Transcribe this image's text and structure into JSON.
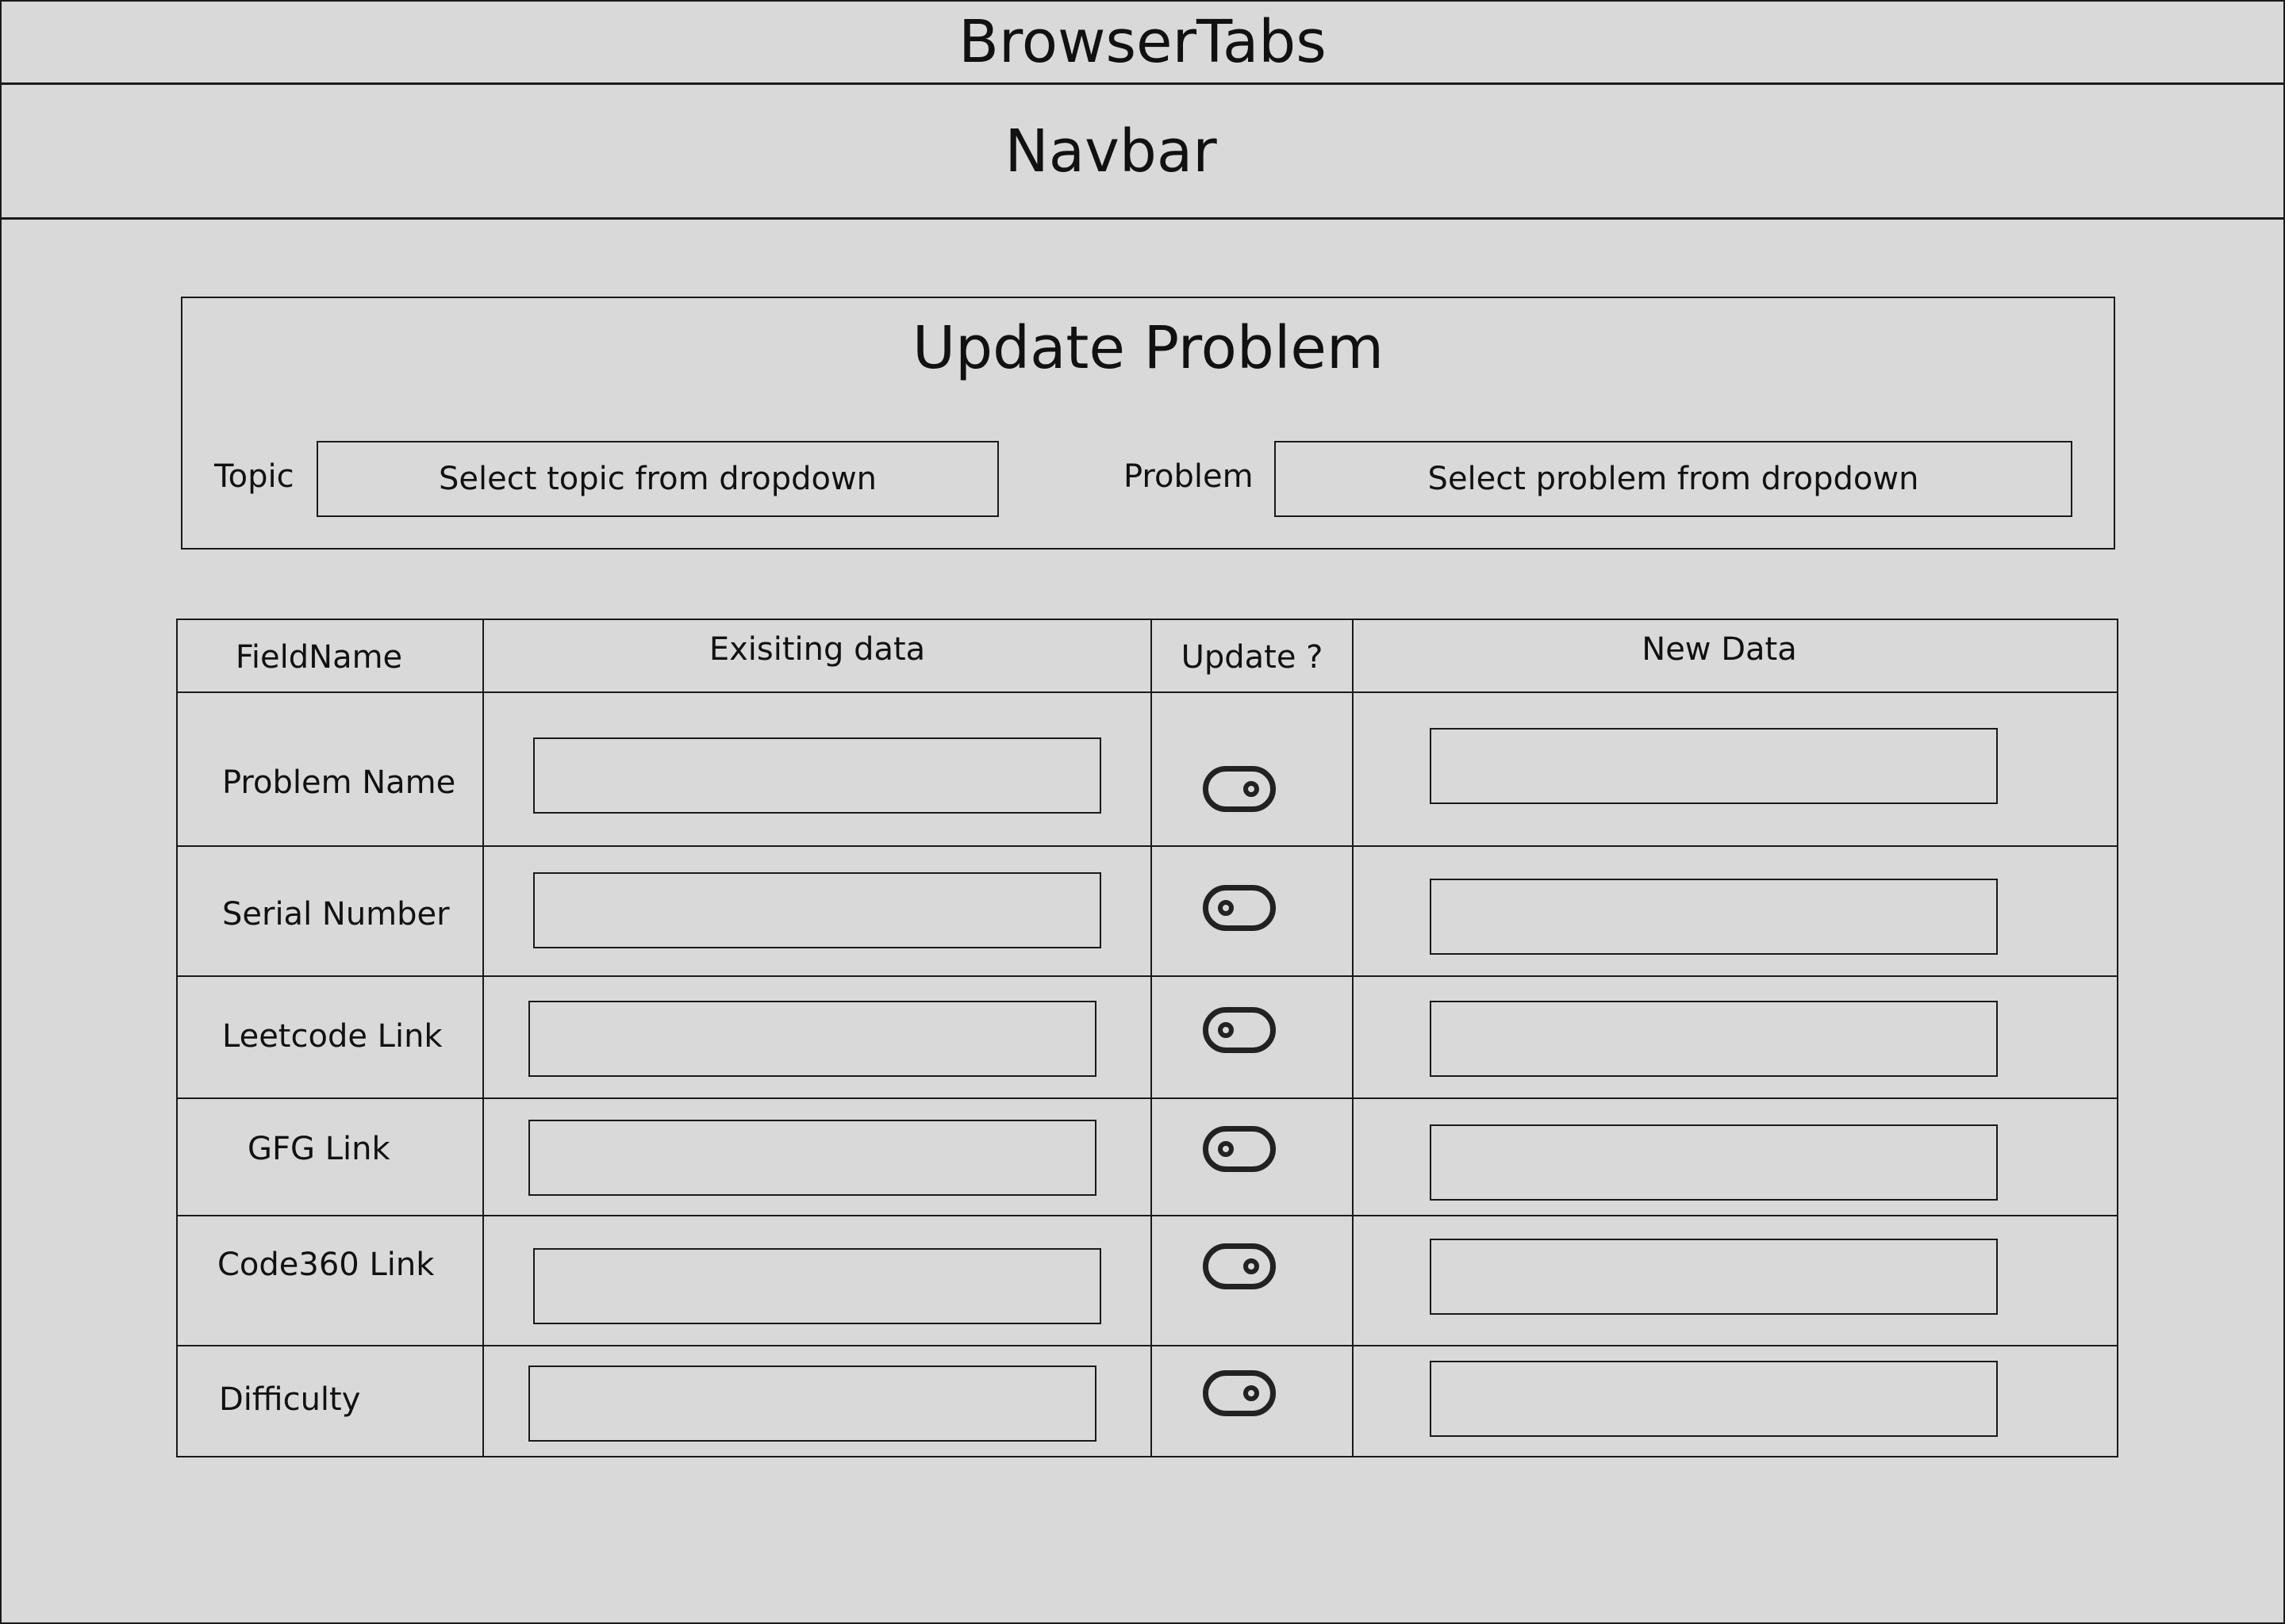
{
  "browser_tabs": {
    "label": "BrowserTabs"
  },
  "navbar": {
    "label": "Navbar"
  },
  "update_panel": {
    "title": "Update Problem",
    "topic": {
      "label": "Topic",
      "placeholder": "Select topic from dropdown"
    },
    "problem": {
      "label": "Problem",
      "placeholder": "Select problem from dropdown"
    }
  },
  "table": {
    "headers": {
      "field_name": "FieldName",
      "existing_data": "Exisiting data",
      "update": "Update ?",
      "new_data": "New Data"
    },
    "rows": [
      {
        "field": "Problem Name",
        "existing_value": "",
        "new_value": "",
        "update_toggle": "on"
      },
      {
        "field": "Serial Number",
        "existing_value": "",
        "new_value": "",
        "update_toggle": "off"
      },
      {
        "field": "Leetcode Link",
        "existing_value": "",
        "new_value": "",
        "update_toggle": "off"
      },
      {
        "field": "GFG Link",
        "existing_value": "",
        "new_value": "",
        "update_toggle": "off"
      },
      {
        "field": "Code360 Link",
        "existing_value": "",
        "new_value": "",
        "update_toggle": "on"
      },
      {
        "field": "Difficulty",
        "existing_value": "",
        "new_value": "",
        "update_toggle": "on"
      }
    ]
  }
}
